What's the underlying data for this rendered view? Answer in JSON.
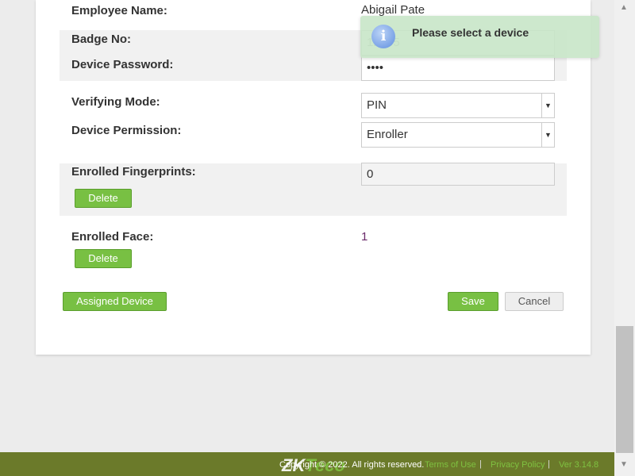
{
  "form": {
    "employee_name_label": "Employee Name:",
    "employee_name": "Abigail Pate",
    "badge_label": "Badge No:",
    "badge_value": "12345",
    "password_label": "Device Password:",
    "password_value": "••••",
    "verify_label": "Verifying Mode:",
    "verify_value": "PIN",
    "permission_label": "Device Permission:",
    "permission_value": "Enroller",
    "fingerprints_label": "Enrolled Fingerprints:",
    "fingerprints_value": "0",
    "face_label": "Enrolled Face:",
    "face_value": "1",
    "delete_label": "Delete",
    "assigned_label": "Assigned Device",
    "save_label": "Save",
    "cancel_label": "Cancel"
  },
  "toast": {
    "message": "Please select a device",
    "icon": "info-icon"
  },
  "footer": {
    "copyright": "Copyright © 2022. All rights reserved.",
    "terms": "Terms of Use",
    "privacy": "Privacy Policy",
    "version": "Ver 3.14.8",
    "logo": "ZKTeco"
  },
  "colors": {
    "accent": "#78c043",
    "footer": "#6b7a2a"
  }
}
